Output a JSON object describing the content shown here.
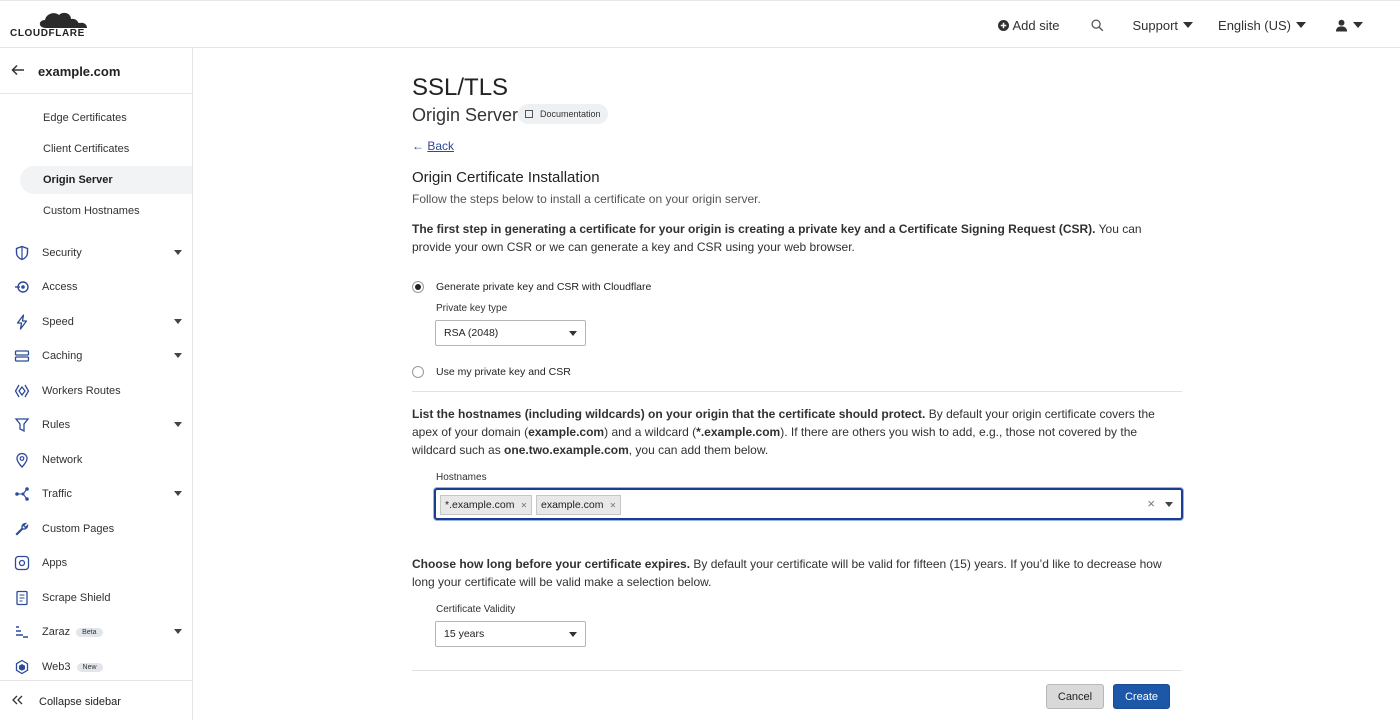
{
  "brand": {
    "name": "CLOUDFLARE",
    "accent": "#f38020"
  },
  "topnav": {
    "add_site": "Add site",
    "support": "Support",
    "language": "English (US)"
  },
  "sidebar": {
    "zone": "example.com",
    "sub_items": [
      "Edge Certificates",
      "Client Certificates",
      "Origin Server",
      "Custom Hostnames"
    ],
    "active_sub": "Origin Server",
    "items": [
      {
        "label": "Security",
        "icon": "shield-icon",
        "expand": true
      },
      {
        "label": "Access",
        "icon": "access-icon",
        "expand": false
      },
      {
        "label": "Speed",
        "icon": "bolt-icon",
        "expand": true
      },
      {
        "label": "Caching",
        "icon": "server-icon",
        "expand": true
      },
      {
        "label": "Workers Routes",
        "icon": "workers-icon",
        "expand": false
      },
      {
        "label": "Rules",
        "icon": "rules-icon",
        "expand": true
      },
      {
        "label": "Network",
        "icon": "location-pin-icon",
        "expand": false
      },
      {
        "label": "Traffic",
        "icon": "traffic-icon",
        "expand": true
      },
      {
        "label": "Custom Pages",
        "icon": "wrench-icon",
        "expand": false
      },
      {
        "label": "Apps",
        "icon": "apps-icon",
        "expand": false
      },
      {
        "label": "Scrape Shield",
        "icon": "document-icon",
        "expand": false
      },
      {
        "label": "Zaraz",
        "icon": "zaraz-icon",
        "expand": true,
        "badge": "Beta"
      },
      {
        "label": "Web3",
        "icon": "web3-icon",
        "expand": false,
        "badge": "New"
      }
    ],
    "collapse": "Collapse sidebar"
  },
  "page": {
    "title": "SSL/TLS",
    "subtitle": "Origin Server",
    "doc_button": "Documentation",
    "back": "Back",
    "section_title": "Origin Certificate Installation",
    "intro": "Follow the steps below to install a certificate on your origin server.",
    "step1_bold": "The first step in generating a certificate for your origin is creating a private key and a Certificate Signing Request (CSR).",
    "step1_rest": " You can provide your own CSR or we can generate a key and CSR using your web browser.",
    "radio_generate": "Generate private key and CSR with Cloudflare",
    "key_type_label": "Private key type",
    "key_type_value": "RSA (2048)",
    "radio_own": "Use my private key and CSR",
    "hosts_bold": "List the hostnames (including wildcards) on your origin that the certificate should protect.",
    "hosts_rest1": " By default your origin certificate covers the apex of your domain (",
    "hosts_apex": "example.com",
    "hosts_rest2": ") and a wildcard (",
    "hosts_wild": "*.example.com",
    "hosts_rest3": "). If there are others you wish to add, e.g., those not covered by the wildcard such as ",
    "hosts_example": "one.two.example.com",
    "hosts_rest4": ", you can add them below.",
    "hostnames_label": "Hostnames",
    "hostnames": [
      "*.example.com",
      "example.com"
    ],
    "expiry_bold": "Choose how long before your certificate expires.",
    "expiry_rest": " By default your certificate will be valid for fifteen (15) years. If you’d like to decrease how long your certificate will be valid make a selection below.",
    "validity_label": "Certificate Validity",
    "validity_value": "15 years",
    "cancel": "Cancel",
    "create": "Create"
  }
}
